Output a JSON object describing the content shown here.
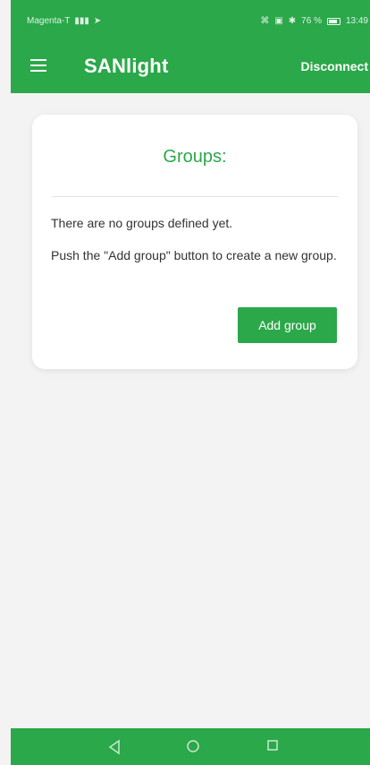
{
  "status_bar": {
    "carrier": "Magenta-T",
    "battery_percent": "76 %",
    "time": "13:49"
  },
  "app_bar": {
    "title": "SANlight",
    "action": "Disconnect"
  },
  "groups_card": {
    "title": "Groups:",
    "line_1": "There are no groups defined yet.",
    "line_2": "Push the \"Add group\" button to create a new group.",
    "button": "Add group"
  },
  "colors": {
    "primary": "#2ba84a",
    "background": "#f3f3f3",
    "card": "#ffffff"
  },
  "icons": {
    "menu": "hamburger-menu-icon",
    "back": "triangle-back-icon",
    "home": "circle-home-icon",
    "recent": "square-recent-apps-icon"
  }
}
